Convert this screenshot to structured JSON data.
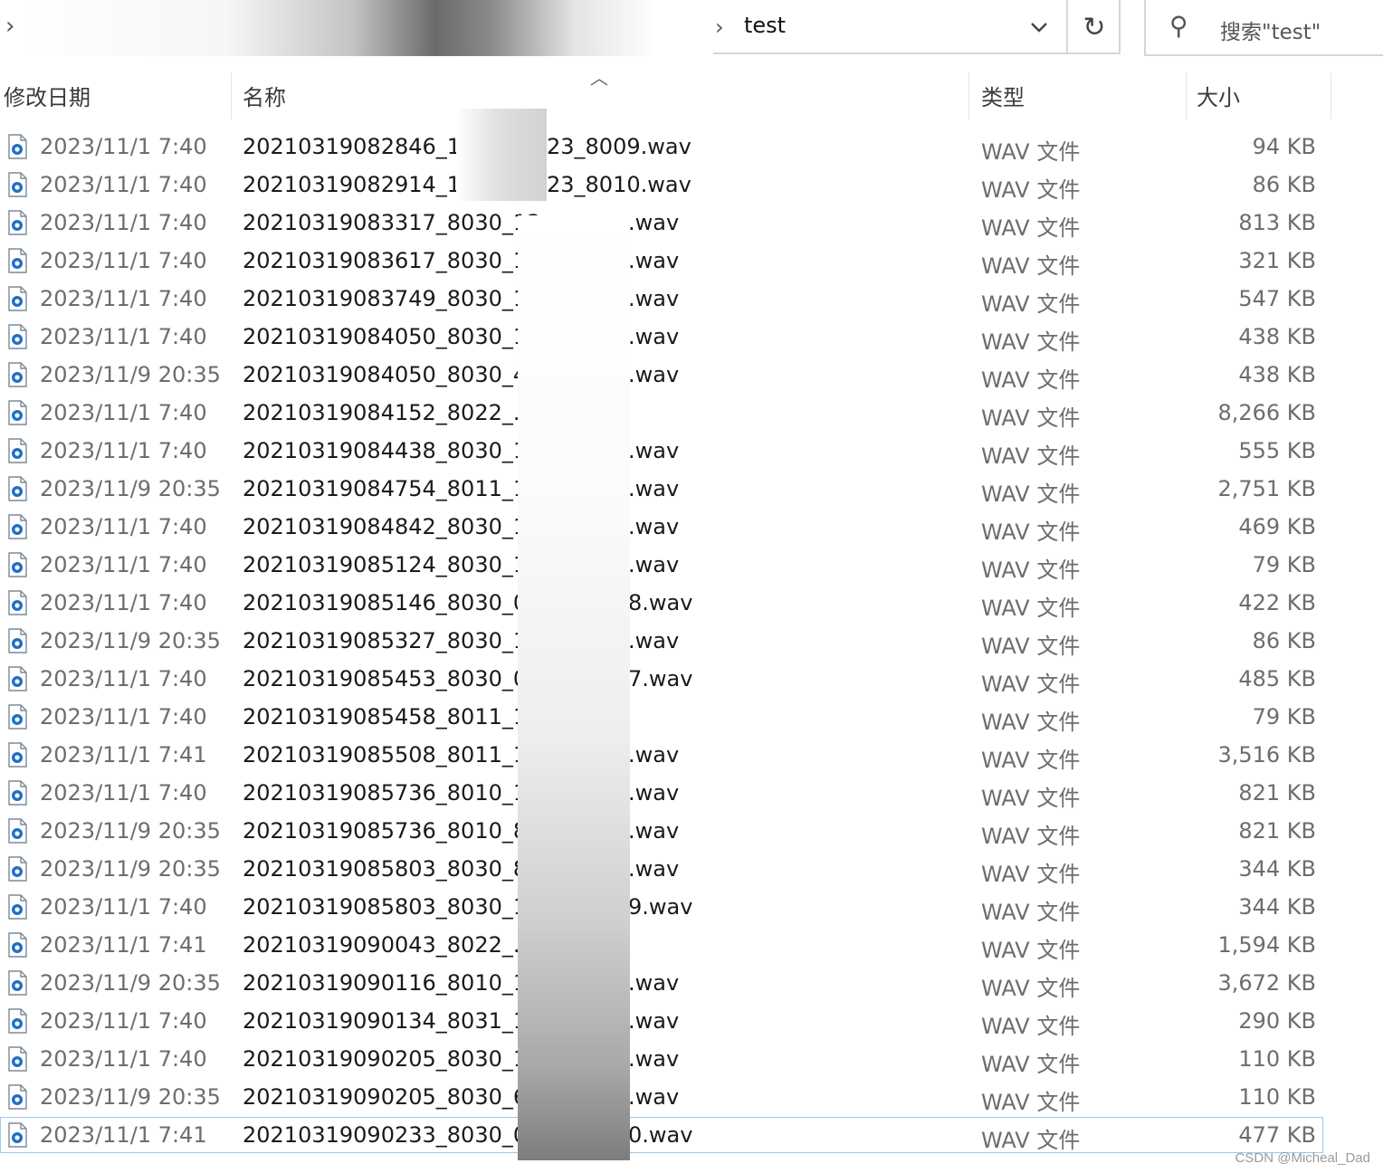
{
  "address_bar": {
    "current_folder": "test",
    "search_placeholder": "搜索\"test\""
  },
  "columns": {
    "date": "修改日期",
    "name": "名称",
    "type": "类型",
    "size": "大小"
  },
  "files": [
    {
      "date": "2023/11/1 7:40",
      "name_start": "20210319082846_18",
      "name_end": "23_8009.wav",
      "type": "WAV 文件",
      "size": "94 KB"
    },
    {
      "date": "2023/11/1 7:40",
      "name_start": "20210319082914_18",
      "name_end": "23_8010.wav",
      "type": "WAV 文件",
      "size": "86 KB"
    },
    {
      "date": "2023/11/1 7:40",
      "name_start": "20210319083317_8030_13",
      "name_end": ".wav",
      "type": "WAV 文件",
      "size": "813 KB"
    },
    {
      "date": "2023/11/1 7:40",
      "name_start": "20210319083617_8030_13",
      "name_end": ".wav",
      "type": "WAV 文件",
      "size": "321 KB"
    },
    {
      "date": "2023/11/1 7:40",
      "name_start": "20210319083749_8030_17",
      "name_end": ".wav",
      "type": "WAV 文件",
      "size": "547 KB"
    },
    {
      "date": "2023/11/1 7:40",
      "name_start": "20210319084050_8030_13",
      "name_end": ".wav",
      "type": "WAV 文件",
      "size": "438 KB"
    },
    {
      "date": "2023/11/9 20:35",
      "name_start": "20210319084050_8030_40",
      "name_end": ".wav",
      "type": "WAV 文件",
      "size": "438 KB"
    },
    {
      "date": "2023/11/1 7:40",
      "name_start": "20210319084152_8022_.wa",
      "name_end": "",
      "type": "WAV 文件",
      "size": "8,266 KB"
    },
    {
      "date": "2023/11/1 7:40",
      "name_start": "20210319084438_8030_13",
      "name_end": ".wav",
      "type": "WAV 文件",
      "size": "555 KB"
    },
    {
      "date": "2023/11/9 20:35",
      "name_start": "20210319084754_8011_10",
      "name_end": ".wav",
      "type": "WAV 文件",
      "size": "2,751 KB"
    },
    {
      "date": "2023/11/1 7:40",
      "name_start": "20210319084842_8030_15",
      "name_end": ".wav",
      "type": "WAV 文件",
      "size": "469 KB"
    },
    {
      "date": "2023/11/1 7:40",
      "name_start": "20210319085124_8030_18",
      "name_end": ".wav",
      "type": "WAV 文件",
      "size": "79 KB"
    },
    {
      "date": "2023/11/1 7:40",
      "name_start": "20210319085146_8030_01",
      "name_end": "8.wav",
      "type": "WAV 文件",
      "size": "422 KB"
    },
    {
      "date": "2023/11/9 20:35",
      "name_start": "20210319085327_8030_18",
      "name_end": ".wav",
      "type": "WAV 文件",
      "size": "86 KB"
    },
    {
      "date": "2023/11/1 7:40",
      "name_start": "20210319085453_8030_01",
      "name_end": "7.wav",
      "type": "WAV 文件",
      "size": "485 KB"
    },
    {
      "date": "2023/11/1 7:40",
      "name_start": "20210319085458_8011_13",
      "name_end": "",
      "type": "WAV 文件",
      "size": "79 KB"
    },
    {
      "date": "2023/11/1 7:41",
      "name_start": "20210319085508_8011_13",
      "name_end": ".wav",
      "type": "WAV 文件",
      "size": "3,516 KB"
    },
    {
      "date": "2023/11/1 7:40",
      "name_start": "20210319085736_8010_13",
      "name_end": ".wav",
      "type": "WAV 文件",
      "size": "821 KB"
    },
    {
      "date": "2023/11/9 20:35",
      "name_start": "20210319085736_8010_81",
      "name_end": ".wav",
      "type": "WAV 文件",
      "size": "821 KB"
    },
    {
      "date": "2023/11/9 20:35",
      "name_start": "20210319085803_8030_83",
      "name_end": ".wav",
      "type": "WAV 文件",
      "size": "344 KB"
    },
    {
      "date": "2023/11/1 7:40",
      "name_start": "20210319085803_8030_13",
      "name_end": "9.wav",
      "type": "WAV 文件",
      "size": "344 KB"
    },
    {
      "date": "2023/11/1 7:41",
      "name_start": "20210319090043_8022_.wa",
      "name_end": "",
      "type": "WAV 文件",
      "size": "1,594 KB"
    },
    {
      "date": "2023/11/9 20:35",
      "name_start": "20210319090116_8010_11",
      "name_end": ".wav",
      "type": "WAV 文件",
      "size": "3,672 KB"
    },
    {
      "date": "2023/11/1 7:40",
      "name_start": "20210319090134_8031_13",
      "name_end": ".wav",
      "type": "WAV 文件",
      "size": "290 KB"
    },
    {
      "date": "2023/11/1 7:40",
      "name_start": "20210319090205_8030_17",
      "name_end": ".wav",
      "type": "WAV 文件",
      "size": "110 KB"
    },
    {
      "date": "2023/11/9 20:35",
      "name_start": "20210319090205_8030_66",
      "name_end": ".wav",
      "type": "WAV 文件",
      "size": "110 KB"
    },
    {
      "date": "2023/11/1 7:41",
      "name_start": "20210319090233_8030_01",
      "name_end": "0.wav",
      "type": "WAV 文件",
      "size": "477 KB",
      "selected": true
    }
  ],
  "watermark": "CSDN @Micheal_Dad",
  "icons": {
    "file": "audio-file-icon",
    "search": "search-icon",
    "refresh": "refresh-icon",
    "dropdown": "chevron-down-icon"
  },
  "colors": {
    "selection_border": "#99c9ef",
    "muted_text": "#6d6d6d"
  }
}
